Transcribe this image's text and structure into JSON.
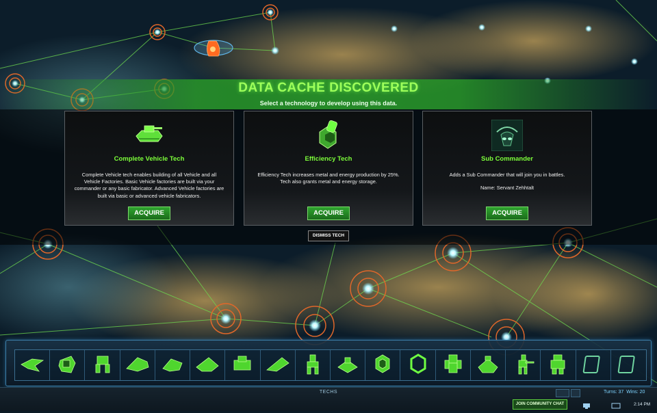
{
  "banner": {
    "title": "DATA CACHE DISCOVERED",
    "subtitle": "Select a technology to develop using this data."
  },
  "cards": [
    {
      "title": "Complete Vehicle Tech",
      "description": "Complete Vehicle tech enables building of all Vehicle and all Vehicle Factories. Basic Vehicle factories are built via your commander or any basic fabricator. Advanced Vehicle factories are built via basic or advanced vehicle fabricators.",
      "extra": "",
      "button": "ACQUIRE",
      "icon": "vehicle-tank-icon"
    },
    {
      "title": "Efficiency Tech",
      "description": "Efficiency Tech increases metal and energy production by 25%. Tech also grants metal and energy storage.",
      "extra": "",
      "button": "ACQUIRE",
      "icon": "efficiency-icon"
    },
    {
      "title": "Sub Commander",
      "description": "Adds a Sub Commander that will join you in battles.",
      "extra": "Name: Servant Zehhtalt",
      "button": "ACQUIRE",
      "icon": "sub-commander-portrait-icon"
    }
  ],
  "dismiss": "DISMISS TECH",
  "tray": {
    "slot_icons": [
      "air-fighter-icon",
      "vehicle-icon",
      "walker-icon",
      "bomber-icon",
      "gunship-icon",
      "air-transport-icon",
      "tank-icon",
      "jet-icon",
      "bot-icon",
      "turret-icon",
      "hex-structure-icon",
      "hex-armor-icon",
      "mech-icon",
      "factory-icon",
      "sniper-bot-icon",
      "commander-icon",
      "empty-slot-icon",
      "empty-slot-icon"
    ]
  },
  "bottom": {
    "techs_label": "TECHS",
    "turns": "Turns: 37",
    "wins": "Wins: 20",
    "join_chat": "JOIN COMMUNITY CHAT",
    "clock": "2:14 PM"
  },
  "colors": {
    "accent_green": "#7dff3a",
    "banner_green": "#2e962e",
    "ui_blue": "#3c7fa8",
    "node_orange": "#e0672a"
  }
}
